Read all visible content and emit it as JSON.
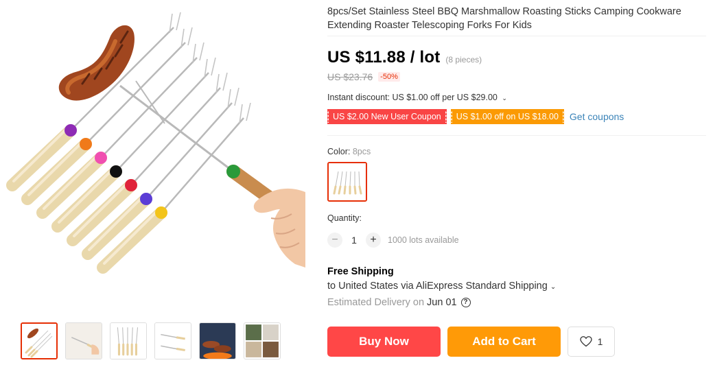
{
  "product": {
    "title": "8pcs/Set Stainless Steel BBQ Marshmallow Roasting Sticks Camping Cookware Extending Roaster Telescoping Forks For Kids"
  },
  "gallery": {
    "main_image": "bbq-roasting-sticks-photo",
    "thumbnails": [
      {
        "name": "sticks-set-thumb",
        "active": true
      },
      {
        "name": "hand-holding-stick-thumb",
        "active": false
      },
      {
        "name": "sticks-fanned-thumb",
        "active": false
      },
      {
        "name": "stick-dimensions-thumb",
        "active": false
      },
      {
        "name": "campfire-sausages-thumb",
        "active": false
      },
      {
        "name": "usage-collage-thumb",
        "active": false
      }
    ]
  },
  "price": {
    "current": "US $11.88 / lot",
    "pieces": "(8 pieces)",
    "original": "US $23.76",
    "discount": "-50%"
  },
  "promotions": {
    "instant_discount": "Instant discount: US $1.00 off per US $29.00",
    "coupon_new_user": "US $2.00 New User Coupon",
    "coupon_off": "US $1.00 off on US $18.00",
    "get_coupons": "Get coupons"
  },
  "variant": {
    "label": "Color: ",
    "selected": "8pcs"
  },
  "quantity": {
    "label": "Quantity:",
    "minus": "−",
    "value": "1",
    "plus": "+",
    "available": "1000 lots available"
  },
  "shipping": {
    "title": "Free Shipping",
    "to": "to United States via AliExpress Standard Shipping",
    "estimated_label": "Estimated Delivery on",
    "date": "Jun 01",
    "help": "?"
  },
  "actions": {
    "buy_now": "Buy Now",
    "add_to_cart": "Add to Cart",
    "wishlist_count": "1"
  },
  "colors": {
    "accent_red": "#ff4747",
    "accent_orange": "#ff9a07",
    "link_blue": "#3a83b8"
  }
}
